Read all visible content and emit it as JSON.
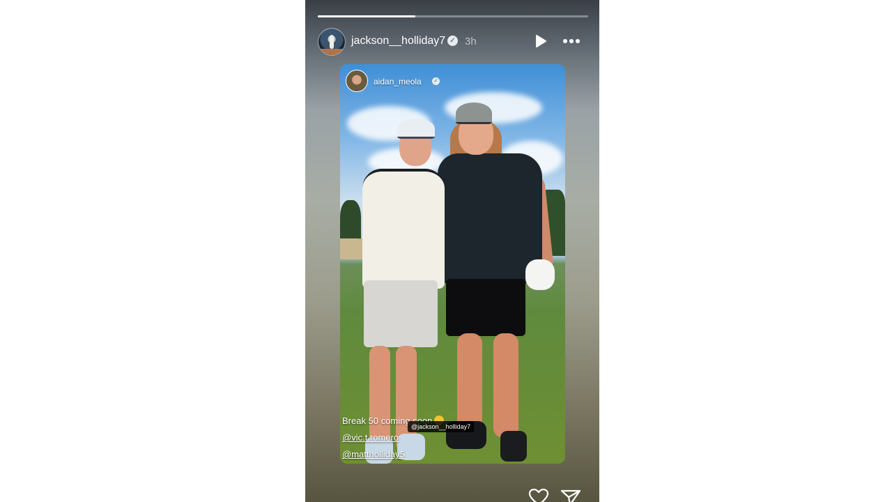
{
  "story": {
    "progress": 0.36,
    "author": {
      "username": "jackson__holliday7",
      "verified_icon": "✓",
      "time_ago": "3h"
    },
    "controls": {
      "play_icon": "play-icon",
      "more_icon": "more-icon"
    },
    "shared_post": {
      "username": "aidan_meola",
      "verified_icon": "✓",
      "caption": "Break 50 coming soon",
      "mention_1": "@vic.t.romero",
      "mention_2": "@mattholliday5",
      "tag": "@jackson__holliday7"
    },
    "footer": {
      "like_icon": "heart-icon",
      "share_icon": "send-icon"
    }
  }
}
